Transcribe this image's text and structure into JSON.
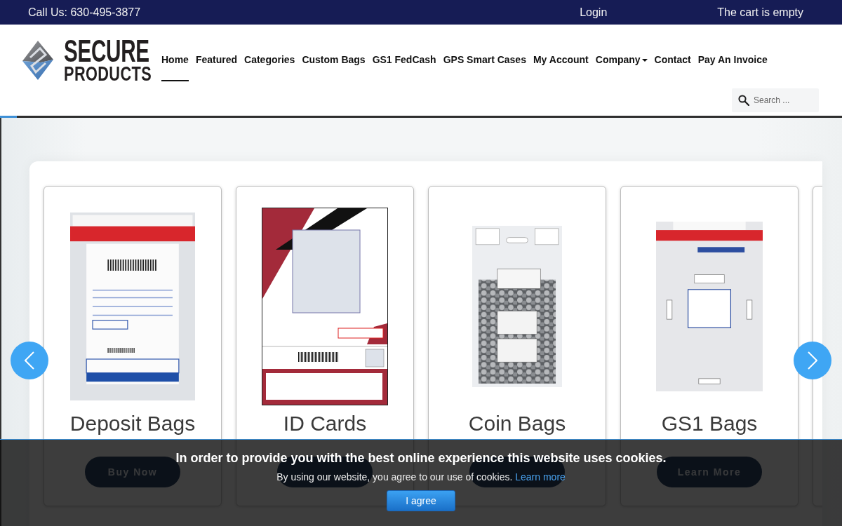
{
  "top_bar": {
    "phone": "Call Us: 630-495-3877",
    "login": "Login",
    "cart": "The cart is empty"
  },
  "header": {
    "logo": {
      "line_1": "SECURE",
      "line_2": "PRODUCTS"
    },
    "nav": [
      {
        "label": "Home",
        "selected": true,
        "dropdown": false
      },
      {
        "label": "Featured",
        "selected": false,
        "dropdown": false
      },
      {
        "label": "Categories",
        "selected": false,
        "dropdown": false
      },
      {
        "label": "Custom Bags",
        "selected": false,
        "dropdown": false
      },
      {
        "label": "GS1 FedCash",
        "selected": false,
        "dropdown": false
      },
      {
        "label": "GPS Smart Cases",
        "selected": false,
        "dropdown": false
      },
      {
        "label": "My Account",
        "selected": false,
        "dropdown": false
      },
      {
        "label": "Company",
        "selected": false,
        "dropdown": true
      },
      {
        "label": "Contact",
        "selected": false,
        "dropdown": false
      },
      {
        "label": "Pay An Invoice",
        "selected": false,
        "dropdown": false
      }
    ],
    "search": {
      "placeholder": "Search ..."
    }
  },
  "carousel": {
    "progress": {
      "level": 0.02
    },
    "cards": [
      {
        "kind": "bag",
        "title": "Deposit Bags",
        "button": {
          "shown": true,
          "label": "Buy Now"
        }
      },
      {
        "kind": "badge",
        "title": "ID Cards",
        "button": {
          "shown": true
        }
      },
      {
        "kind": "coins",
        "title": "Coin Bags",
        "button": {
          "shown": true
        }
      },
      {
        "kind": "envelope",
        "title": "GS1 Bags",
        "button": {
          "shown": true,
          "label": "Learn More"
        }
      }
    ]
  },
  "cookie_banner": {
    "heading": "In order to provide you with the best online experience this website uses cookies.",
    "text": "By using our website, you agree to our use of cookies.",
    "link": "Learn more",
    "button": "I agree"
  }
}
